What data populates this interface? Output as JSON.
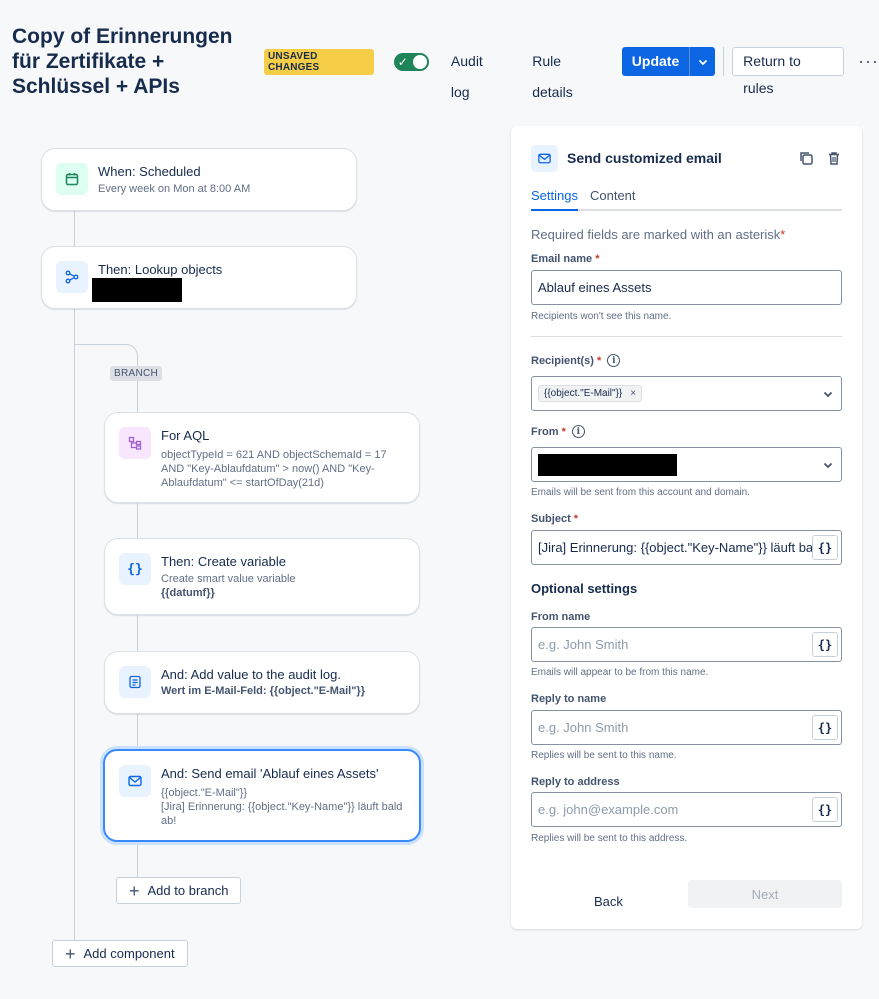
{
  "header": {
    "title": "Copy of Erinnerungen für Zertifikate + Schlüssel + APIs",
    "unsaved_label": "UNSAVED CHANGES",
    "toggle_check": "✓",
    "audit_log_label": "Audit log",
    "rule_details_label": "Rule details",
    "update_label": "Update",
    "return_label": "Return to rules",
    "more_label": "···"
  },
  "canvas": {
    "trigger": {
      "title": "When: Scheduled",
      "subtitle": "Every week on Mon at 8:00 AM"
    },
    "lookup": {
      "title": "Then: Lookup objects"
    },
    "branch_label": "BRANCH",
    "for_aql": {
      "title": "For AQL",
      "subtitle": "objectTypeId = 621 AND objectSchemaId = 17 AND \"Key-Ablaufdatum\" > now() AND \"Key-Ablaufdatum\" <= startOfDay(21d)"
    },
    "create_variable": {
      "title": "Then: Create variable",
      "subtitle": "Create smart value variable",
      "bold": "{{datumf}}"
    },
    "audit_log": {
      "title": "And: Add value to the audit log.",
      "bold": "Wert im E-Mail-Feld: {{object.\"E-Mail\"}}"
    },
    "send_email": {
      "title": "And: Send email 'Ablauf eines Assets'",
      "line1": "{{object.\"E-Mail\"}}",
      "line2": "[Jira] Erinnerung: {{object.\"Key-Name\"}} läuft bald ab!"
    },
    "add_to_branch_label": "Add to branch",
    "add_component_label": "Add component"
  },
  "panel": {
    "title": "Send customized email",
    "tabs": [
      "Settings",
      "Content"
    ],
    "required_note": "Required fields are marked with an asterisk",
    "asterisk": "*",
    "email_name": {
      "label": "Email name",
      "value": "Ablauf eines Assets",
      "helper": "Recipients won't see this name."
    },
    "recipients": {
      "label": "Recipient(s)",
      "chip": "{{object.\"E-Mail\"}}",
      "chip_remove": "×"
    },
    "from": {
      "label": "From",
      "helper": "Emails will be sent from this account and domain."
    },
    "subject": {
      "label": "Subject",
      "value": "[Jira] Erinnerung: {{object.\"Key-Name\"}} läuft bald ab!"
    },
    "optional_title": "Optional settings",
    "from_name": {
      "label": "From name",
      "placeholder": "e.g. John Smith",
      "helper": "Emails will appear to be from this name."
    },
    "reply_to_name": {
      "label": "Reply to name",
      "placeholder": "e.g. John Smith",
      "helper": "Replies will be sent to this name."
    },
    "reply_to_address": {
      "label": "Reply to address",
      "placeholder": "e.g. john@example.com",
      "helper": "Replies will be sent to this address."
    },
    "curly_label": "{}",
    "info_label": "i",
    "back_label": "Back",
    "next_label": "Next"
  },
  "colors": {
    "primary": "#0c66e4",
    "success": "#1f845a",
    "warning": "#f5cd47",
    "selected_border": "#388bff"
  }
}
